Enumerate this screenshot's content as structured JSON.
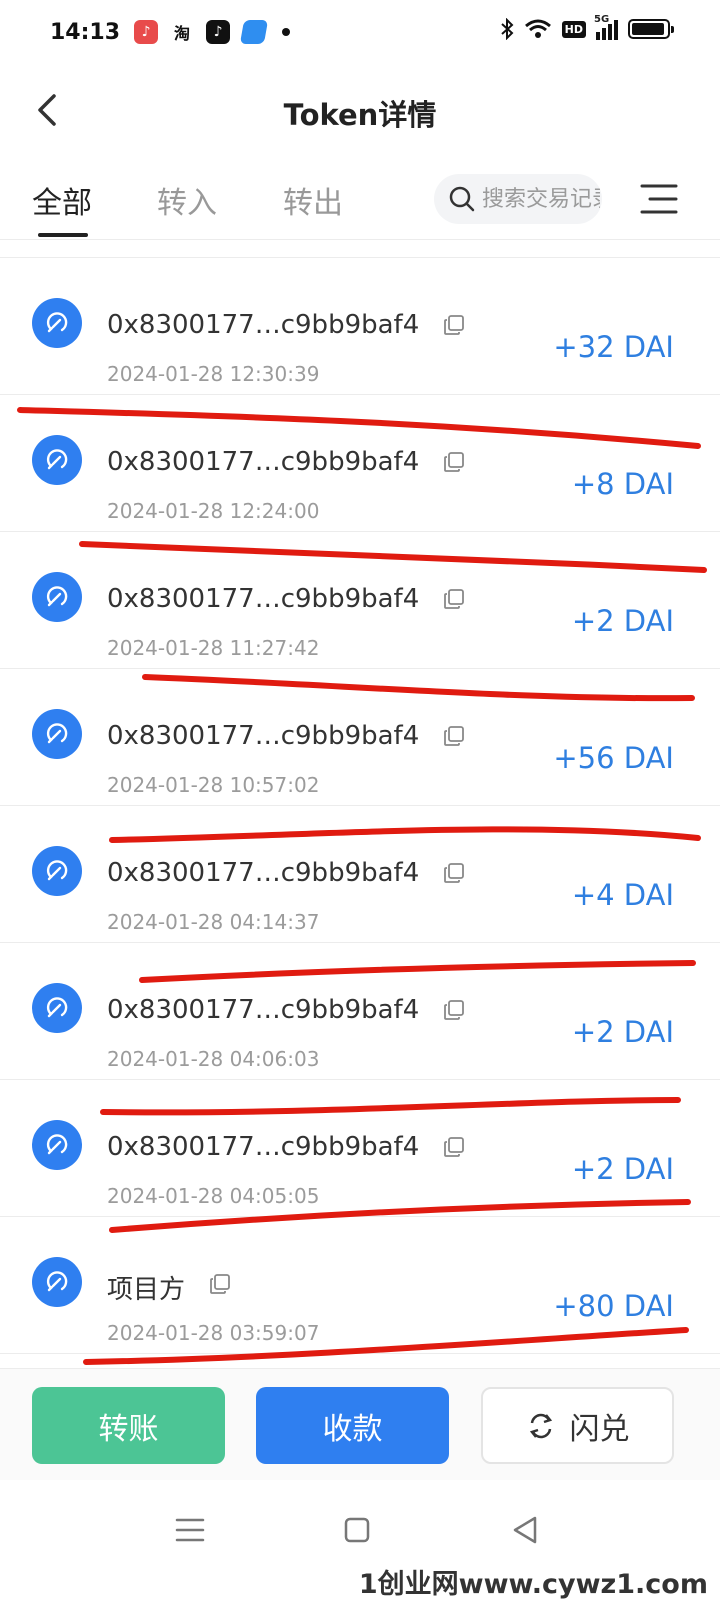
{
  "status_bar": {
    "time": "14:13",
    "apps": [
      {
        "name": "music-app-icon",
        "glyph": "♪",
        "color": "#e84b4b"
      },
      {
        "name": "taobao-app-icon",
        "glyph": "淘",
        "color": "#ff7a1a"
      },
      {
        "name": "tiktok-app-icon",
        "glyph": "♪",
        "color": "#111111"
      },
      {
        "name": "blue-app-icon",
        "glyph": "",
        "color": "#2f8ef0"
      }
    ],
    "hd_label": "HD",
    "network_label": "5G",
    "battery_level": 0.95
  },
  "header": {
    "title": "Token详情"
  },
  "tabs": [
    {
      "label": "全部",
      "active": true
    },
    {
      "label": "转入",
      "active": false
    },
    {
      "label": "转出",
      "active": false
    }
  ],
  "search": {
    "placeholder": "搜索交易记录"
  },
  "transactions": [
    {
      "address": "0x8300177…c9bb9baf4",
      "time": "2024-01-28 12:30:39",
      "amount": "+32 DAI"
    },
    {
      "address": "0x8300177…c9bb9baf4",
      "time": "2024-01-28 12:24:00",
      "amount": "+8 DAI"
    },
    {
      "address": "0x8300177…c9bb9baf4",
      "time": "2024-01-28 11:27:42",
      "amount": "+2 DAI"
    },
    {
      "address": "0x8300177…c9bb9baf4",
      "time": "2024-01-28 10:57:02",
      "amount": "+56 DAI"
    },
    {
      "address": "0x8300177…c9bb9baf4",
      "time": "2024-01-28 04:14:37",
      "amount": "+4 DAI"
    },
    {
      "address": "0x8300177…c9bb9baf4",
      "time": "2024-01-28 04:06:03",
      "amount": "+2 DAI"
    },
    {
      "address": "0x8300177…c9bb9baf4",
      "time": "2024-01-28 04:05:05",
      "amount": "+2 DAI"
    },
    {
      "address": "项目方",
      "time": "2024-01-28 03:59:07",
      "amount": "+80 DAI"
    }
  ],
  "actions": {
    "transfer_label": "转账",
    "receive_label": "收款",
    "swap_label": "闪兑"
  },
  "colors": {
    "accent_blue": "#2f7ff0",
    "amount_blue": "#2f7fe0",
    "transfer_green": "#4cc595",
    "annotation_red": "#e01b10"
  },
  "watermark": "1创业网www.cywz1.com"
}
